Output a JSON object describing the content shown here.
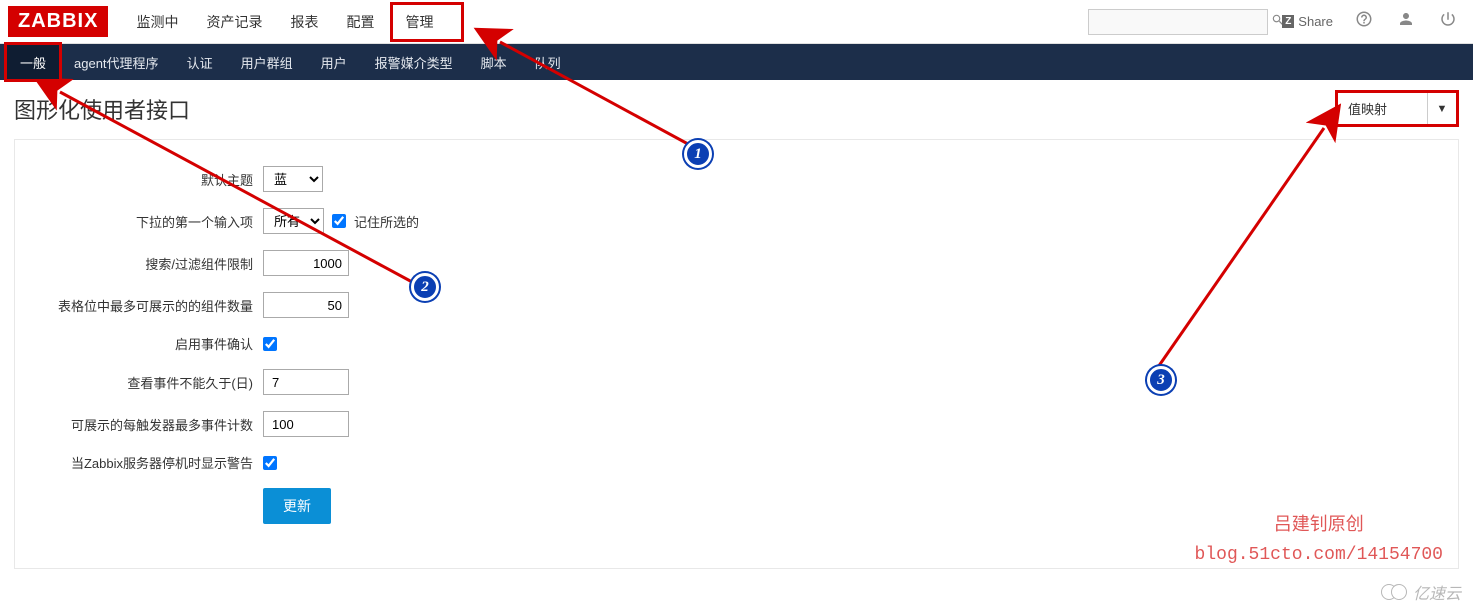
{
  "logo_text": "ZABBIX",
  "topnav": {
    "items": [
      "监测中",
      "资产记录",
      "报表",
      "配置",
      "管理"
    ]
  },
  "topright": {
    "share": "Share"
  },
  "subnav": {
    "items": [
      "一般",
      "agent代理程序",
      "认证",
      "用户群组",
      "用户",
      "报警媒介类型",
      "脚本",
      "队列"
    ]
  },
  "page_title": "图形化使用者接口",
  "dropdown": {
    "selected": "值映射"
  },
  "form": {
    "default_theme": {
      "label": "默认主题",
      "value": "蓝"
    },
    "first_input": {
      "label": "下拉的第一个输入项",
      "value": "所有",
      "remember": "记住所选的"
    },
    "search_limit": {
      "label": "搜索/过滤组件限制",
      "value": "1000"
    },
    "max_items": {
      "label": "表格位中最多可展示的的组件数量",
      "value": "50"
    },
    "enable_ack": {
      "label": "启用事件确认"
    },
    "event_days": {
      "label": "查看事件不能久于(日)",
      "value": "7"
    },
    "max_triggers": {
      "label": "可展示的每触发器最多事件计数",
      "value": "100"
    },
    "show_warn": {
      "label": "当Zabbix服务器停机时显示警告"
    },
    "submit": "更新"
  },
  "callouts": {
    "c1": "1",
    "c2": "2",
    "c3": "3"
  },
  "watermark": {
    "l1": "吕建钊原创",
    "l2": "blog.51cto.com/14154700"
  },
  "footer_brand": "亿速云"
}
